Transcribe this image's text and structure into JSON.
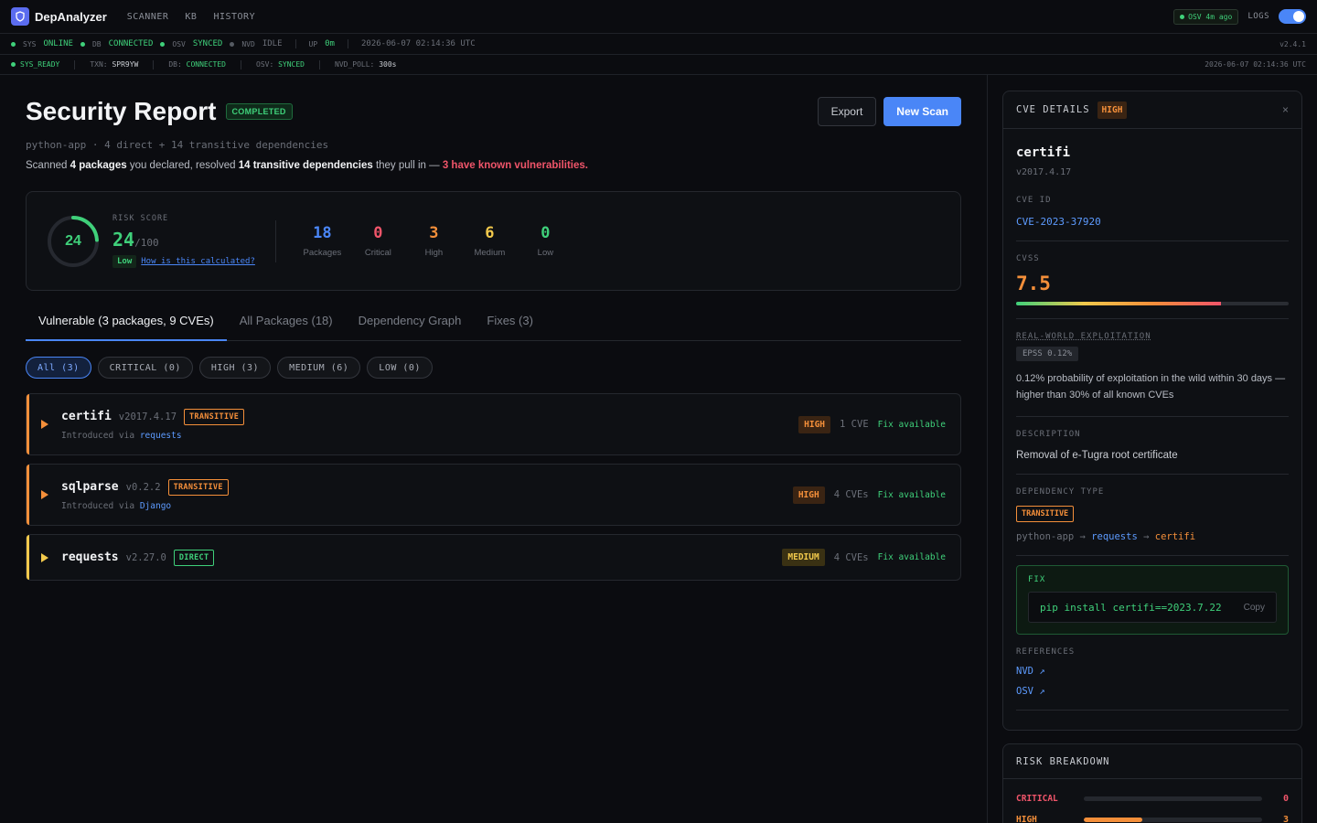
{
  "app": {
    "name": "DepAnalyzer"
  },
  "nav": {
    "links": [
      "SCANNER",
      "KB",
      "HISTORY"
    ],
    "osv_pill": "OSV 4m ago",
    "logs_label": "LOGS"
  },
  "status1": {
    "sys_key": "SYS",
    "sys_val": "ONLINE",
    "db_key": "DB",
    "db_val": "CONNECTED",
    "osv_key": "OSV",
    "osv_val": "SYNCED",
    "nvd_key": "NVD",
    "nvd_val": "IDLE",
    "up_key": "UP",
    "up_val": "0m",
    "time": "2026-06-07 02:14:36 UTC",
    "version": "v2.4.1"
  },
  "status2": {
    "ready": "SYS_READY",
    "txn_key": "TXN:",
    "txn_val": "SPR9YW",
    "db_key": "DB:",
    "db_val": "CONNECTED",
    "osv_key": "OSV:",
    "osv_val": "SYNCED",
    "nvd_key": "NVD_POLL:",
    "nvd_val": "300s",
    "time": "2026-06-07 02:14:36 UTC"
  },
  "report": {
    "title": "Security Report",
    "status": "COMPLETED",
    "export_label": "Export",
    "new_scan_label": "New Scan",
    "subtitle": "python-app · 4 direct + 14 transitive dependencies",
    "scan_pre": "Scanned ",
    "scan_pkgs": "4 packages",
    "scan_mid": " you declared, resolved ",
    "scan_trans": "14 transitive dependencies",
    "scan_post": " they pull in — ",
    "scan_bad": "3 have known vulnerabilities."
  },
  "risk": {
    "gauge_value": "24",
    "score_fraction": 0.24,
    "label": "RISK SCORE",
    "score": "24",
    "of": "/100",
    "level": "Low",
    "calc_link": "How is this calculated?",
    "stats": [
      {
        "value": "18",
        "label": "Packages",
        "color": "#4a86f7"
      },
      {
        "value": "0",
        "label": "Critical",
        "color": "#f0556a"
      },
      {
        "value": "3",
        "label": "High",
        "color": "#f48f3a"
      },
      {
        "value": "6",
        "label": "Medium",
        "color": "#f2c94c"
      },
      {
        "value": "0",
        "label": "Low",
        "color": "#3fd07a"
      }
    ]
  },
  "tabs": [
    "Vulnerable (3 packages, 9 CVEs)",
    "All Packages (18)",
    "Dependency Graph",
    "Fixes (3)"
  ],
  "filters": [
    "All (3)",
    "CRITICAL (0)",
    "HIGH (3)",
    "MEDIUM (6)",
    "LOW (0)"
  ],
  "packages": [
    {
      "name": "certifi",
      "version": "v2017.4.17",
      "type": "TRANSITIVE",
      "via_label": "Introduced via",
      "via": "requests",
      "severity": "HIGH",
      "cves": "1 CVE",
      "fix": "Fix available"
    },
    {
      "name": "sqlparse",
      "version": "v0.2.2",
      "type": "TRANSITIVE",
      "via_label": "Introduced via",
      "via": "Django",
      "severity": "HIGH",
      "cves": "4 CVEs",
      "fix": "Fix available"
    },
    {
      "name": "requests",
      "version": "v2.27.0",
      "type": "DIRECT",
      "severity": "MEDIUM",
      "cves": "4 CVEs",
      "fix": "Fix available"
    }
  ],
  "cve": {
    "head_title": "CVE DETAILS",
    "severity": "HIGH",
    "package": "certifi",
    "version": "v2017.4.17",
    "id_label": "CVE ID",
    "id": "CVE-2023-37920",
    "cvss_label": "CVSS",
    "cvss": "7.5",
    "cvss_fraction": 0.75,
    "exploit_label": "REAL-WORLD EXPLOITATION",
    "epss": "EPSS 0.12%",
    "exploit_text": "0.12% probability of exploitation in the wild within 30 days — higher than 30% of all known CVEs",
    "desc_label": "DESCRIPTION",
    "description": "Removal of e-Tugra root certificate",
    "dep_label": "DEPENDENCY TYPE",
    "dep_type": "TRANSITIVE",
    "chain_root": "python-app",
    "chain_arrow": "→",
    "chain_mid": "requests",
    "chain_target": "certifi",
    "fix_label": "FIX",
    "fix_cmd": "pip install certifi==2023.7.22",
    "copy_label": "Copy",
    "refs_label": "REFERENCES",
    "refs": [
      "NVD ↗",
      "OSV ↗"
    ]
  },
  "breakdown": {
    "title": "RISK BREAKDOWN",
    "rows": [
      {
        "name": "CRITICAL",
        "value": "0",
        "fraction": 0,
        "color": "#f0556a"
      },
      {
        "name": "HIGH",
        "value": "3",
        "fraction": 0.33,
        "color": "#f48f3a"
      }
    ]
  }
}
